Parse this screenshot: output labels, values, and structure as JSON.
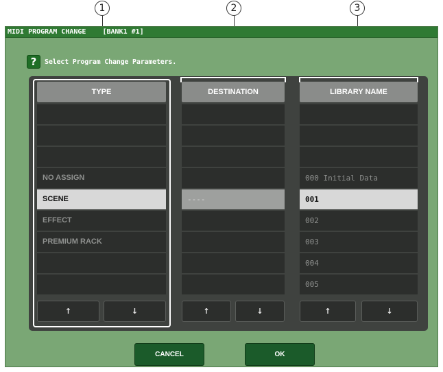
{
  "callouts": [
    "1",
    "2",
    "3"
  ],
  "window": {
    "title": "MIDI PROGRAM CHANGE    [BANK1 #1]",
    "hint": "Select Program Change Parameters."
  },
  "columns": {
    "type": {
      "header": "TYPE",
      "rows": [
        "",
        "",
        "",
        "NO ASSIGN",
        "SCENE",
        "EFFECT",
        "PREMIUM RACK",
        "",
        ""
      ],
      "selected_index": 4
    },
    "destination": {
      "header": "DESTINATION",
      "rows": [
        "",
        "",
        "",
        "",
        "----",
        "",
        "",
        "",
        ""
      ],
      "selected_index": 4
    },
    "library": {
      "header": "LIBRARY NAME",
      "rows": [
        "",
        "",
        "",
        "000 Initial Data",
        "001",
        "002",
        "003",
        "004",
        "005"
      ],
      "selected_index": 4
    }
  },
  "scroll_buttons": {
    "up": "↑",
    "down": "↓"
  },
  "buttons": {
    "cancel": "CANCEL",
    "ok": "OK"
  }
}
